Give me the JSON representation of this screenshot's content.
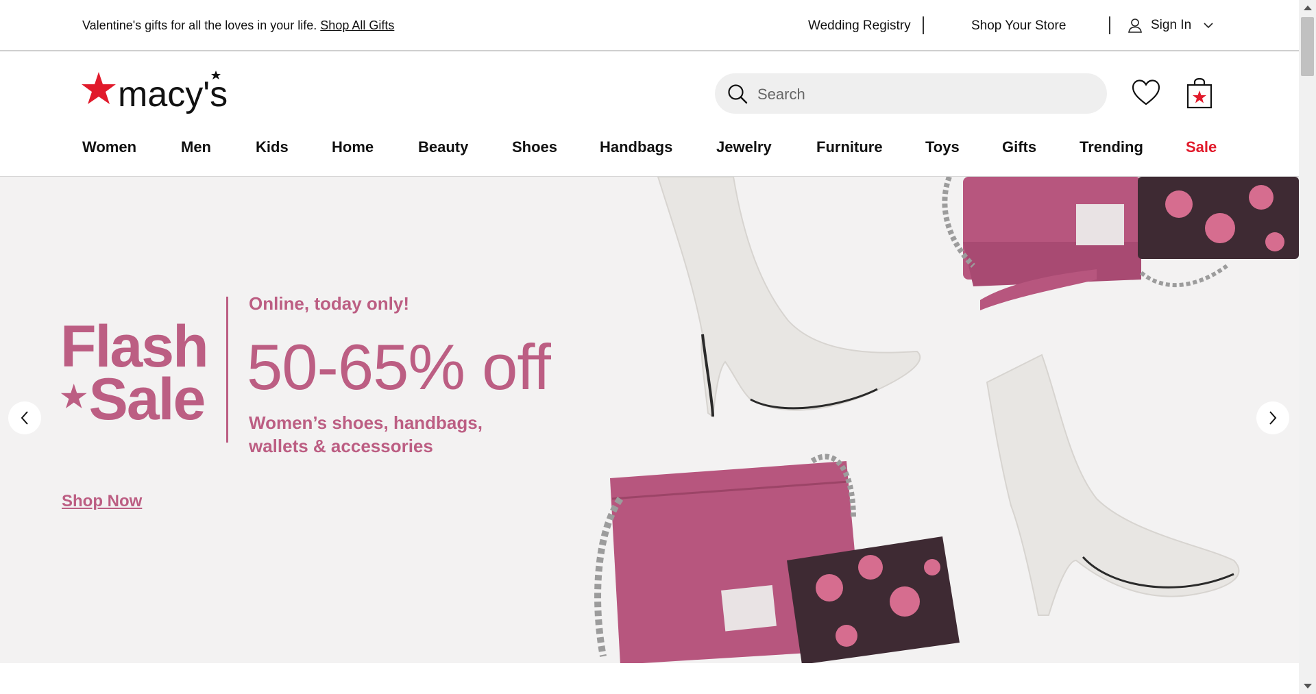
{
  "utility_bar": {
    "promo_text": "Valentine's gifts for all the loves in your life.",
    "promo_link": "Shop All Gifts",
    "wedding_registry": "Wedding Registry",
    "shop_your_store": "Shop Your Store",
    "sign_in": "Sign In"
  },
  "header": {
    "logo_text": "macy's",
    "search_placeholder": "Search",
    "brand_color": "#e11a2b"
  },
  "nav": {
    "items": [
      "Women",
      "Men",
      "Kids",
      "Home",
      "Beauty",
      "Shoes",
      "Handbags",
      "Jewelry",
      "Furniture",
      "Toys",
      "Gifts",
      "Trending",
      "Sale"
    ]
  },
  "hero": {
    "flash_line1": "Flash",
    "flash_line2": "Sale",
    "tagline": "Online, today only!",
    "discount": "50-65% off",
    "description": "Women’s shoes, handbags, wallets & accessories",
    "cta": "Shop Now",
    "accent_color": "#bc5e83",
    "icons": {
      "prev": "chevron-left-icon",
      "next": "chevron-right-icon"
    }
  },
  "icons": {
    "search": "search-icon",
    "wishlist": "heart-icon",
    "bag": "shopping-bag-icon",
    "user": "user-icon",
    "dropdown": "chevron-down-icon"
  }
}
